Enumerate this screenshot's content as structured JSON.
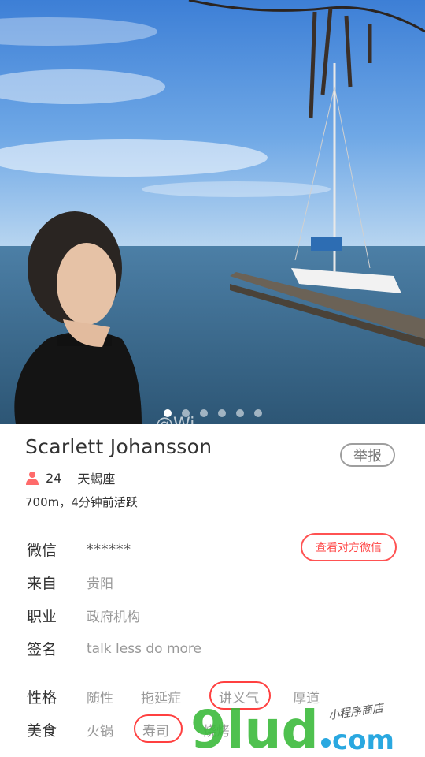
{
  "hero": {
    "carousel_dots": 6,
    "active_dot": 0,
    "watermark_partial": "@Wi"
  },
  "profile": {
    "name": "Scarlett Johansson",
    "report_label": "举报",
    "age": "24",
    "zodiac": "天蝎座",
    "activity": "700m，4分钟前活跃"
  },
  "info": {
    "wechat_label": "微信",
    "wechat_value": "******",
    "wechat_button": "查看对方微信",
    "from_label": "来自",
    "from_value": "贵阳",
    "job_label": "职业",
    "job_value": "政府机构",
    "sign_label": "签名",
    "sign_value": "talk less do more"
  },
  "tags": {
    "personality_label": "性格",
    "personality": [
      "随性",
      "拖延症",
      "讲义气",
      "厚道"
    ],
    "food_label": "美食",
    "food": [
      "火锅",
      "寿司",
      "烧烤"
    ]
  },
  "watermark": {
    "logo_text": "9lud.com",
    "subtitle": "小程序商店"
  },
  "colors": {
    "accent": "#ff4444",
    "person_icon": "#ff6b6b",
    "logo_green": "#3dbb3d",
    "logo_dot": "#2aa8e0"
  }
}
